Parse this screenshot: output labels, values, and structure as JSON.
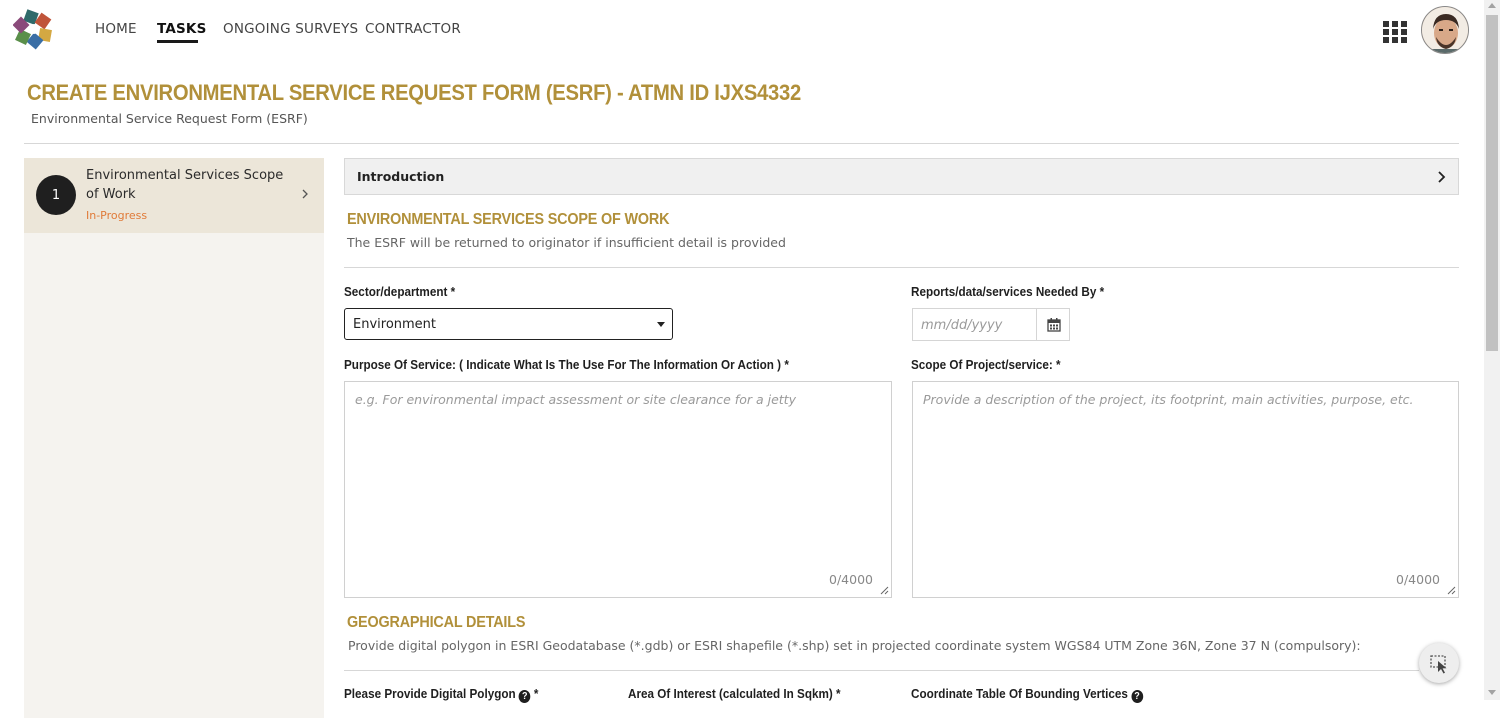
{
  "nav": {
    "items": [
      {
        "label": "HOME"
      },
      {
        "label": "TASKS",
        "active": true
      },
      {
        "label": "ONGOING SURVEYS"
      },
      {
        "label": "CONTRACTOR"
      }
    ],
    "icons": [
      "logo-icon",
      "apps-grid-icon",
      "avatar"
    ]
  },
  "page": {
    "title": "CREATE ENVIRONMENTAL SERVICE REQUEST FORM (ESRF) - ATMN ID IJXS4332",
    "subtitle": "Environmental Service Request Form (ESRF)"
  },
  "sidebar": {
    "steps": [
      {
        "number": "1",
        "title": "Environmental Services Scope of Work",
        "status": "In-Progress"
      }
    ]
  },
  "intro": {
    "label": "Introduction"
  },
  "scope_section": {
    "title": "ENVIRONMENTAL SERVICES SCOPE OF WORK",
    "desc": "The ESRF will be returned to originator if insufficient detail is provided"
  },
  "fields": {
    "sector": {
      "label": "Sector/department *",
      "value": "Environment"
    },
    "needed_by": {
      "label": "Reports/data/services Needed By *",
      "placeholder": "mm/dd/yyyy"
    },
    "purpose": {
      "label": "Purpose Of Service: ( Indicate What Is The Use For The Information Or Action ) *",
      "placeholder": "e.g. For environmental impact assessment or site clearance for a jetty",
      "count": "0/4000"
    },
    "scope": {
      "label": "Scope Of Project/service: *",
      "placeholder": "Provide a description of the project, its footprint, main activities, purpose, etc.",
      "count": "0/4000"
    }
  },
  "geo_section": {
    "title": "GEOGRAPHICAL DETAILS",
    "desc": "Provide digital polygon in ESRI Geodatabase (*.gdb) or ESRI shapefile (*.shp)  set in projected coordinate system WGS84 UTM Zone 36N, Zone 37 N (compulsory):"
  },
  "geo_fields": {
    "polygon": {
      "label": "Please Provide Digital Polygon",
      "suffix": "*"
    },
    "area": {
      "label": "Area Of Interest (calculated In Sqkm) *"
    },
    "coords": {
      "label": "Coordinate Table Of Bounding Vertices"
    }
  },
  "colors": {
    "accent": "#b1903a",
    "status": "#e07a38",
    "sidebar_bg": "#f5f3ef",
    "step_bg": "#ece6d9"
  }
}
